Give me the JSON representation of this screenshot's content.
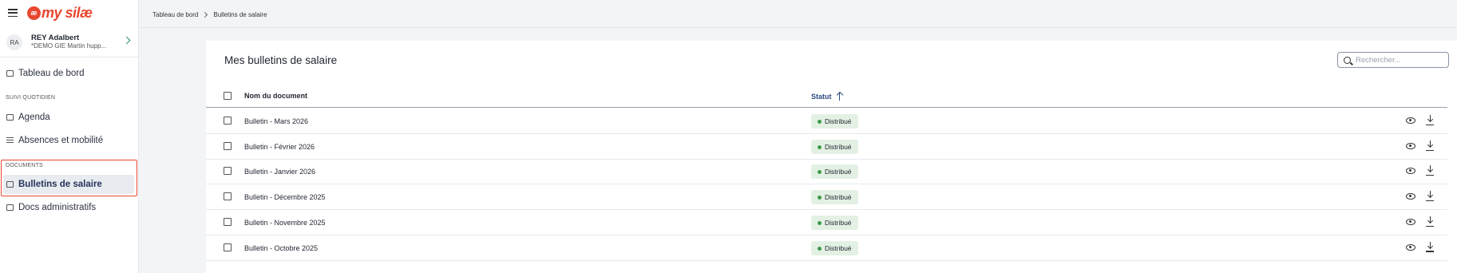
{
  "app": {
    "logo_mark": "æ",
    "logo_text": "my silæ"
  },
  "user": {
    "initials": "RA",
    "name": "REY Adalbert",
    "company": "*DEMO GIE Martin hupp..."
  },
  "nav": {
    "dashboard": "Tableau de bord",
    "section_daily": "SUIVI QUOTIDIEN",
    "agenda": "Agenda",
    "absences": "Absences et mobilité",
    "section_documents": "DOCUMENTS",
    "payslips": "Bulletins de salaire",
    "admin_docs": "Docs administratifs"
  },
  "breadcrumb": {
    "home": "Tableau de bord",
    "current": "Bulletins de salaire"
  },
  "page": {
    "title": "Mes bulletins de salaire"
  },
  "search": {
    "placeholder": "Rechercher..."
  },
  "table": {
    "columns": {
      "name": "Nom du document",
      "status": "Statut"
    },
    "rows": [
      {
        "name": "Bulletin - Mars 2026",
        "status": "Distribué"
      },
      {
        "name": "Bulletin - Février 2026",
        "status": "Distribué"
      },
      {
        "name": "Bulletin - Janvier 2026",
        "status": "Distribué"
      },
      {
        "name": "Bulletin - Décembre 2025",
        "status": "Distribué"
      },
      {
        "name": "Bulletin - Novembre 2025",
        "status": "Distribué"
      },
      {
        "name": "Bulletin - Octobre 2025",
        "status": "Distribué"
      }
    ]
  },
  "colors": {
    "brand": "#e8462f",
    "status_green": "#3f9a4b",
    "link_blue": "#2c4a7e"
  },
  "icons": [
    "menu-icon",
    "chevron-right-icon",
    "dashboard-icon",
    "agenda-icon",
    "list-icon",
    "document-icon",
    "folder-icon",
    "search-icon",
    "sort-asc-icon",
    "eye-icon",
    "download-icon"
  ]
}
